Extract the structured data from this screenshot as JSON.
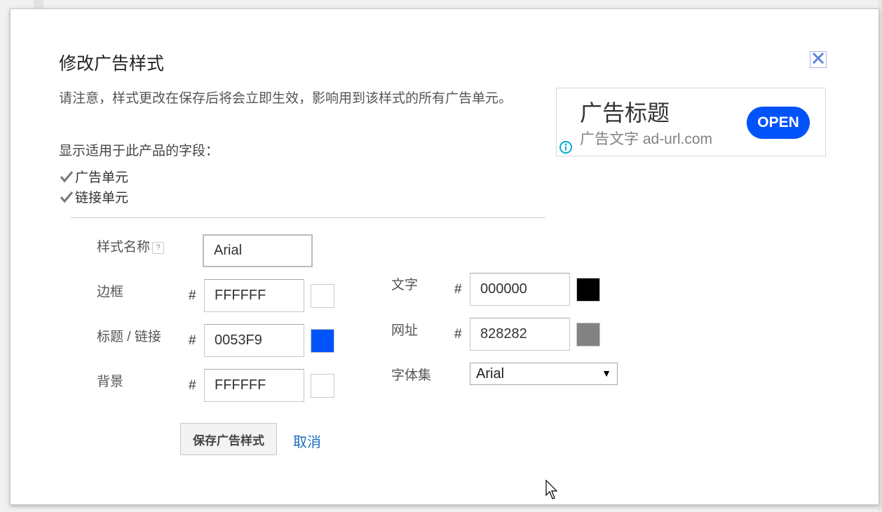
{
  "dialog": {
    "title": "修改广告样式",
    "note": "请注意，样式更改在保存后将会立即生效，影响用到该样式的所有广告单元。",
    "fields_label": "显示适用于此产品的字段：",
    "checkboxes": [
      {
        "label": "广告单元",
        "checked": true
      },
      {
        "label": "链接单元",
        "checked": true
      }
    ]
  },
  "ad_preview": {
    "title": "广告标题",
    "text": "广告文字 ad-url.com",
    "open_label": "OPEN",
    "info_icon": "info-icon",
    "colors": {
      "button": "#0053F9",
      "url": "#828282"
    }
  },
  "form": {
    "style_name_label": "样式名称",
    "style_name_help": "?",
    "style_name_value": "Arial",
    "hash": "#",
    "border": {
      "label": "边框",
      "value": "FFFFFF",
      "color": "#FFFFFF"
    },
    "title_link": {
      "label": "标题 / 链接",
      "value": "0053F9",
      "color": "#0053F9"
    },
    "background": {
      "label": "背景",
      "value": "FFFFFF",
      "color": "#FFFFFF"
    },
    "text": {
      "label": "文字",
      "value": "000000",
      "color": "#000000"
    },
    "url": {
      "label": "网址",
      "value": "828282",
      "color": "#828282"
    },
    "font_family": {
      "label": "字体集",
      "selected": "Arial"
    }
  },
  "actions": {
    "save_label": "保存广告样式",
    "cancel_label": "取消"
  }
}
